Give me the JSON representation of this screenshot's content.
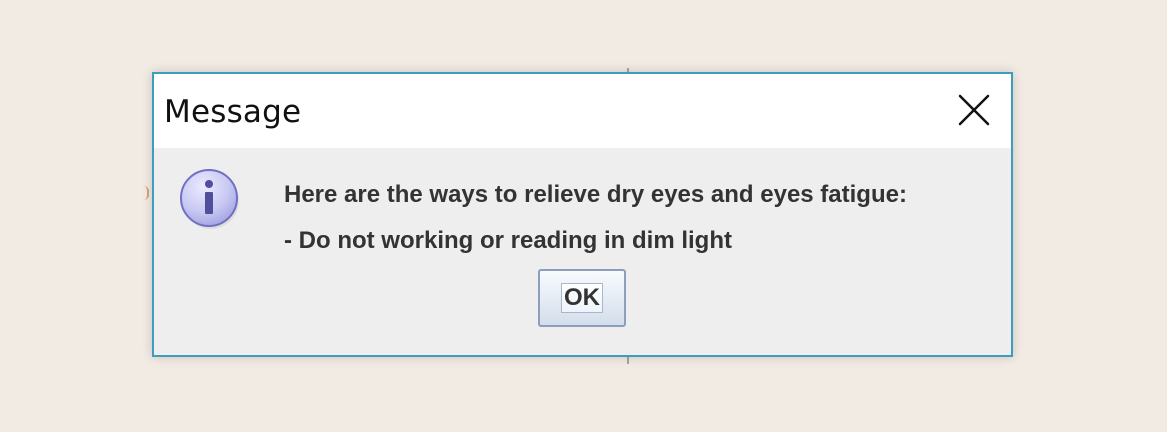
{
  "dialog": {
    "title": "Message",
    "icon": "info-icon",
    "message_lines": [
      "Here are the ways to relieve dry eyes and eyes fatigue:",
      "- Do not working or reading in dim light"
    ],
    "ok_label": "OK"
  },
  "colors": {
    "background": "#f2ebe3",
    "dialog_border": "#3d9dbf",
    "dialog_body": "#eeeeee",
    "titlebar": "#ffffff",
    "info_icon_fill": "#c8c8f3",
    "info_icon_glyph": "#5c5ca8"
  }
}
